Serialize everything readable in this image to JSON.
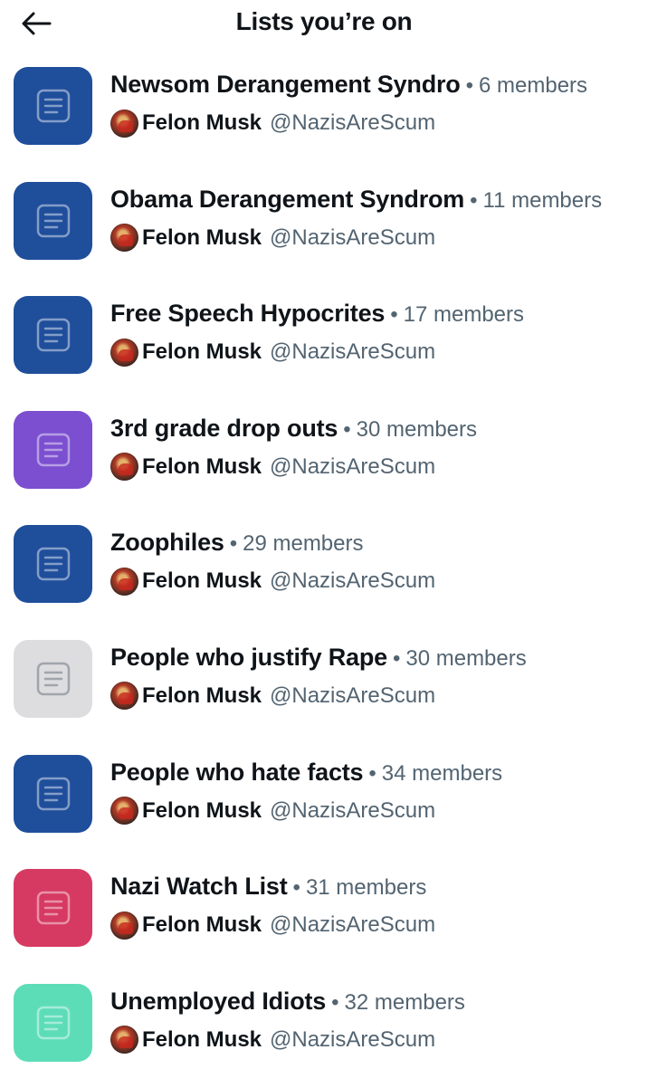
{
  "header": {
    "title": "Lists you’re on",
    "back_icon": "arrow-left-icon"
  },
  "lists": [
    {
      "name": "Newsom Derangement Syndro",
      "separator": "•",
      "members": "6 members",
      "owner_name": "Felon Musk",
      "owner_handle": "@NazisAreScum",
      "color": "#1f4e9b"
    },
    {
      "name": "Obama Derangement Syndrom",
      "separator": "•",
      "members": "11 members",
      "owner_name": "Felon Musk",
      "owner_handle": "@NazisAreScum",
      "color": "#1f4e9b"
    },
    {
      "name": "Free Speech Hypocrites",
      "separator": "•",
      "members": "17 members",
      "owner_name": "Felon Musk",
      "owner_handle": "@NazisAreScum",
      "color": "#1f4e9b"
    },
    {
      "name": "3rd grade drop outs",
      "separator": "•",
      "members": "30 members",
      "owner_name": "Felon Musk",
      "owner_handle": "@NazisAreScum",
      "color": "#7b4fcf"
    },
    {
      "name": "Zoophiles",
      "separator": "•",
      "members": "29 members",
      "owner_name": "Felon Musk",
      "owner_handle": "@NazisAreScum",
      "color": "#1f4e9b"
    },
    {
      "name": "People who justify Rape",
      "separator": "•",
      "members": "30 members",
      "owner_name": "Felon Musk",
      "owner_handle": "@NazisAreScum",
      "color": "#dddddf"
    },
    {
      "name": "People who hate facts",
      "separator": "•",
      "members": "34 members",
      "owner_name": "Felon Musk",
      "owner_handle": "@NazisAreScum",
      "color": "#1f4e9b"
    },
    {
      "name": "Nazi Watch List",
      "separator": "•",
      "members": "31 members",
      "owner_name": "Felon Musk",
      "owner_handle": "@NazisAreScum",
      "color": "#d63a62"
    },
    {
      "name": "Unemployed Idiots",
      "separator": "•",
      "members": "32 members",
      "owner_name": "Felon Musk",
      "owner_handle": "@NazisAreScum",
      "color": "#5ddcb8"
    }
  ],
  "icons": {
    "list_icon": "list-document-icon",
    "owner_avatar": "avatar"
  }
}
